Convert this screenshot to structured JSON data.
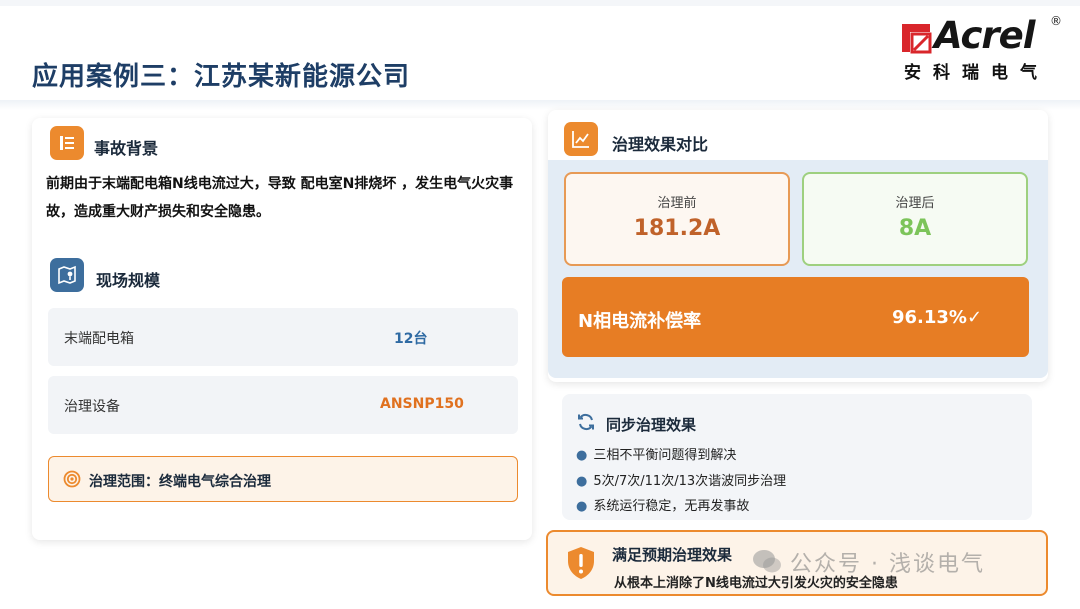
{
  "header": {
    "title": "应用案例三：江苏某新能源公司"
  },
  "logo": {
    "brand": "Acrel",
    "reg_mark": "®",
    "chinese_name": "安科瑞电气"
  },
  "background": {
    "title": "事故背景",
    "icon": "document-list-icon",
    "text": "前期由于末端配电箱N线电流过大，导致 配电室N排烧坏 ，发生电气火灾事故，造成重大财产损失和安全隐患。"
  },
  "site_scale": {
    "title": "现场规模",
    "icon": "map-pin-icon",
    "rows": [
      {
        "label": "末端配电箱",
        "value": "12台"
      },
      {
        "label": "治理设备",
        "value": "ANSNP150"
      }
    ],
    "scope": "治理范围：终端电气综合治理",
    "scope_icon": "target-icon"
  },
  "comparison": {
    "title": "治理效果对比",
    "icon": "trend-chart-icon",
    "before_label": "治理前",
    "before_value": "181.2A",
    "after_label": "治理后",
    "after_value": "8A",
    "rate_label": "N相电流补偿率",
    "rate_value": "96.13%✓"
  },
  "sync": {
    "title": "同步治理效果",
    "icon": "refresh-icon",
    "items": [
      "三相不平衡问题得到解决",
      "5次/7次/11次/13次谐波同步治理",
      "系统运行稳定，无再发事故"
    ]
  },
  "expectation": {
    "title": "满足预期治理效果",
    "subtitle": "从根本上消除了N线电流过大引发火灾的安全隐患",
    "icon": "shield-icon"
  },
  "watermark": {
    "text": "公众号 · 浅谈电气"
  },
  "colors": {
    "title_blue": "#1e3e66",
    "accent_orange": "#ec8a2e",
    "before_value": "#c0622a",
    "after_value": "#7cc45a",
    "row_value_blue": "#2f6aa3",
    "row_value_orange": "#e0711f"
  }
}
